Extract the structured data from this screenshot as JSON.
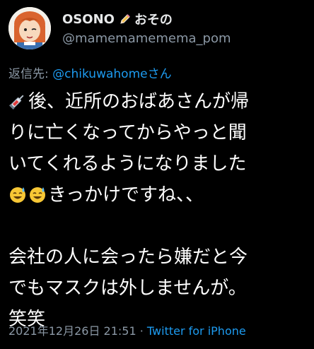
{
  "user": {
    "display_name": "OSONO",
    "display_name_suffix": "おその",
    "name_icon": "pencil-icon",
    "handle": "@mamemamemema_pom",
    "avatar_icon": "cartoon-avatar"
  },
  "reply": {
    "prefix": "返信先: ",
    "mention": "@chikuwahomeさん"
  },
  "body": {
    "lines": [
      "後、近所のおばあさんが帰",
      "りに亡くなってからやっと聞",
      "いてくれるようになりました",
      "きっかけですね、、",
      "会社の人に会ったら嫌だと今",
      "でもマスクは外しませんが。",
      "笑笑"
    ],
    "emojis": [
      "syringe-emoji",
      "sweat-smile-emoji",
      "sweat-smile-emoji"
    ]
  },
  "meta": {
    "timestamp": "2021年12月26日 21:51",
    "separator": " · ",
    "source": "Twitter for iPhone"
  },
  "colors": {
    "background": "#000000",
    "text": "#ffffff",
    "secondary": "#8b98a5",
    "link": "#1d9bf0"
  }
}
